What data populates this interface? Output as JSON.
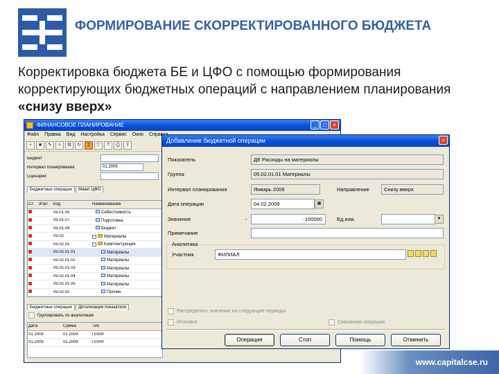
{
  "slide": {
    "title": "Формирование скорректированного бюджета",
    "lead_text": "Корректировка бюджета БЕ и ЦФО с помощью формирования корректирующих бюджетных операций с направлением планирования",
    "lead_bold": "«снизу вверх»",
    "footer_url": "www.capitalcse.ru",
    "colors": {
      "brand": "#2d5ba6",
      "title": "#35619c",
      "xp_title": "#0a53d6"
    }
  },
  "main_window": {
    "title": "ФИНАНСОВОЕ ПЛАНИРОВАНИЕ",
    "menu": [
      "Файл",
      "Правка",
      "Вид",
      "Настройка",
      "Сервис",
      "Окно",
      "Справка"
    ],
    "fields": [
      {
        "label": "Бюджет",
        "value": ""
      },
      {
        "label": "Интервал планирования",
        "value": "01.2009"
      },
      {
        "label": "Сценарий",
        "value": ""
      }
    ],
    "tabs": [
      "Бюджетные операции",
      "Макет ЦФО"
    ],
    "columns": [
      "Ст.",
      "Этап",
      "Код",
      "Наименование"
    ],
    "rows": [
      {
        "stage": "",
        "code": "05.01.05",
        "name": "Себестоимость"
      },
      {
        "stage": "",
        "code": "05.01.07",
        "name": "Подготовка"
      },
      {
        "stage": "",
        "code": "05.01.09",
        "name": "Бюджет"
      },
      {
        "stage": "",
        "code": "05.02",
        "name": "Материалы"
      },
      {
        "stage": "",
        "code": "05.02.01",
        "name": "Комплектующие"
      },
      {
        "stage": "",
        "code": "05.02.01.01",
        "name": "Материалы"
      },
      {
        "stage": "",
        "code": "05.02.01.02",
        "name": "Материалы"
      },
      {
        "stage": "",
        "code": "05.02.01.03",
        "name": "Материалы"
      },
      {
        "stage": "",
        "code": "05.02.01.04",
        "name": "Материалы"
      },
      {
        "stage": "",
        "code": "05.02.01.05",
        "name": "Материалы"
      },
      {
        "stage": "",
        "code": "05.02.02",
        "name": "Прочие"
      }
    ],
    "bottom_tabs": [
      "Бюджетные операции",
      "Детализация показателя"
    ],
    "bottom_checkbox": "Группировать по аналитикам",
    "bottom_columns": [
      "Дата",
      "Сумма",
      "Тип"
    ],
    "bottom_rows": [
      {
        "date": "01.2009",
        "sum": "01.2009",
        "type": "ПЛАН"
      },
      {
        "date": "01.2009",
        "sum": "01.2009",
        "type": "ПЛАН"
      }
    ]
  },
  "dialog": {
    "title": "Добавление бюджетной операции",
    "labels": {
      "indicator": "Показатель",
      "group": "Группа",
      "interval": "Интервал планирования",
      "direction": "Направление",
      "op_date": "Дата операции",
      "value": "Значение",
      "unit": "Ед.изм.",
      "note": "Примечание",
      "analytics": "Аналитика",
      "account": "Участник"
    },
    "values": {
      "indicator": "ДЕ Расходы на материалы",
      "group": "05.02.01.01 Материалы",
      "interval": "Январь 2009",
      "direction": "Снизу вверх",
      "op_date": "04.02.2009",
      "value_sign": "-",
      "value": "-100000",
      "unit": "",
      "note": "",
      "account": "ФИЛИАЛ"
    },
    "checkboxes": [
      "Распределять значение на следующие периоды",
      "Итоговое",
      "Связанная операция"
    ],
    "buttons": [
      "Операция",
      "Стоп",
      "Помощь",
      "Отменить"
    ]
  }
}
